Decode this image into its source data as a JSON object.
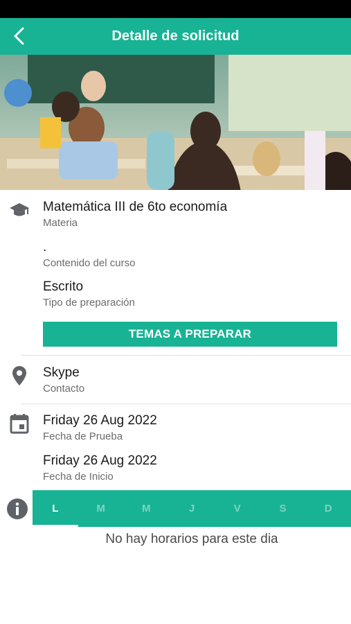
{
  "header": {
    "title": "Detalle de solicitud",
    "accent_color": "#17b394",
    "back_icon": "chevron-left-icon"
  },
  "hero": {
    "icon": "classroom-photo"
  },
  "details": {
    "materia": {
      "value": "Matemática III de 6to economía",
      "label": "Materia",
      "icon": "graduation-cap-icon"
    },
    "contenido": {
      "value": ".",
      "label": "Contenido del curso"
    },
    "preparacion": {
      "value": "Escrito",
      "label": "Tipo de preparación"
    },
    "temas_button": "TEMAS A PREPARAR",
    "contacto": {
      "value": "Skype",
      "label": "Contacto",
      "icon": "location-pin-icon"
    },
    "fecha_prueba": {
      "value": "Friday 26 Aug 2022",
      "label": "Fecha de Prueba",
      "icon": "calendar-icon"
    },
    "fecha_inicio": {
      "value": "Friday 26 Aug 2022",
      "label": "Fecha de Inicio"
    }
  },
  "schedule": {
    "info_icon": "info-icon",
    "days": [
      "L",
      "M",
      "M",
      "J",
      "V",
      "S",
      "D"
    ],
    "selected_day": "L",
    "empty_message": "No hay horarios para este dia"
  }
}
